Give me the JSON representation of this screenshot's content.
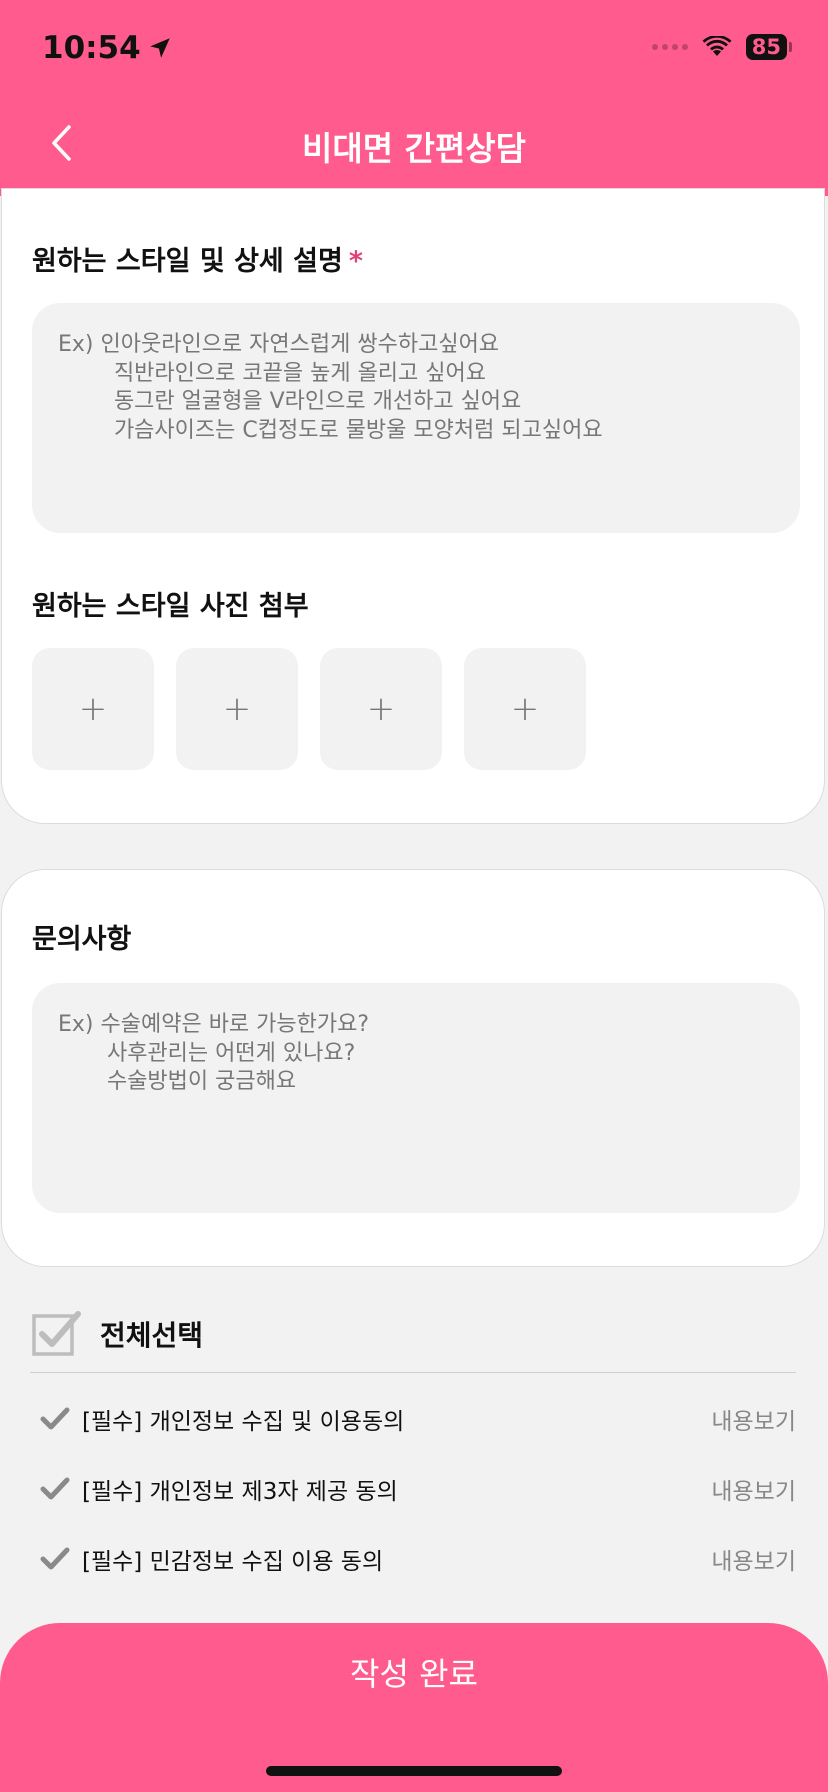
{
  "status_bar": {
    "time": "10:54",
    "battery": "85"
  },
  "header": {
    "title": "비대면 간편상담"
  },
  "style_section": {
    "title": "원하는 스타일 및 상세 설명",
    "required_mark": "*",
    "placeholder": "Ex) 인아웃라인으로 자연스럽게 쌍수하고싶어요\n        직반라인으로 코끝을 높게 올리고 싶어요\n        동그란 얼굴형을 V라인으로 개선하고 싶어요\n        가슴사이즈는 C컵정도로 물방울 모양처럼 되고싶어요"
  },
  "photo_section": {
    "title": "원하는 스타일 사진 첨부",
    "slots": [
      "+",
      "+",
      "+",
      "+"
    ]
  },
  "inquiry_section": {
    "title": "문의사항",
    "placeholder": "Ex) 수술예약은 바로 가능한가요?\n       사후관리는 어떤게 있나요?\n       수술방법이 궁금해요"
  },
  "agreements": {
    "select_all_label": "전체선택",
    "items": [
      {
        "label": "[필수] 개인정보 수집 및 이용동의",
        "view": "내용보기"
      },
      {
        "label": "[필수] 개인정보 제3자 제공 동의",
        "view": "내용보기"
      },
      {
        "label": "[필수] 민감정보 수집 이용 동의",
        "view": "내용보기"
      }
    ]
  },
  "submit": {
    "label": "작성 완료"
  },
  "colors": {
    "accent": "#ff5b8f",
    "required": "#e0407a",
    "background": "#f2f2f2"
  }
}
